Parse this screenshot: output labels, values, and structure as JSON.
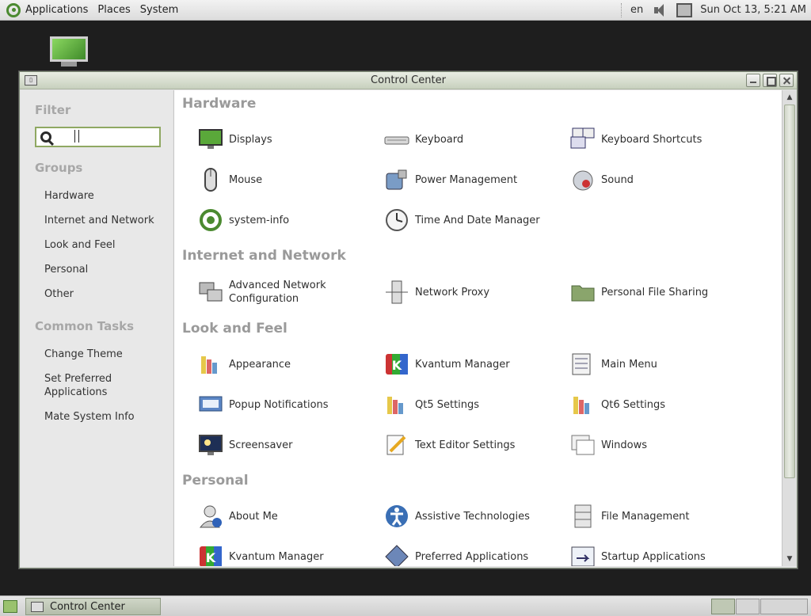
{
  "top_panel": {
    "menus": [
      "Applications",
      "Places",
      "System"
    ],
    "keyboard_layout": "en",
    "clock": "Sun Oct 13,  5:21 AM"
  },
  "window": {
    "title": "Control Center"
  },
  "sidebar": {
    "filter_heading": "Filter",
    "filter_value": "",
    "groups_heading": "Groups",
    "groups": [
      "Hardware",
      "Internet and Network",
      "Look and Feel",
      "Personal",
      "Other"
    ],
    "tasks_heading": "Common Tasks",
    "tasks": [
      "Change Theme",
      "Set Preferred Applications",
      "Mate System Info"
    ]
  },
  "content": {
    "categories": [
      {
        "name": "Hardware",
        "items": [
          {
            "label": "Displays",
            "icon": "display-icon"
          },
          {
            "label": "Keyboard",
            "icon": "keyboard-icon"
          },
          {
            "label": "Keyboard Shortcuts",
            "icon": "keyboard-shortcuts-icon"
          },
          {
            "label": "Mouse",
            "icon": "mouse-icon"
          },
          {
            "label": "Power Management",
            "icon": "power-management-icon"
          },
          {
            "label": "Sound",
            "icon": "sound-icon"
          },
          {
            "label": "system-info",
            "icon": "system-info-icon"
          },
          {
            "label": "Time And Date Manager",
            "icon": "clock-icon"
          }
        ]
      },
      {
        "name": "Internet and Network",
        "items": [
          {
            "label": "Advanced Network Configuration",
            "icon": "network-config-icon"
          },
          {
            "label": "Network Proxy",
            "icon": "network-proxy-icon"
          },
          {
            "label": "Personal File Sharing",
            "icon": "folder-share-icon"
          }
        ]
      },
      {
        "name": "Look and Feel",
        "items": [
          {
            "label": "Appearance",
            "icon": "appearance-icon"
          },
          {
            "label": "Kvantum Manager",
            "icon": "kvantum-icon"
          },
          {
            "label": "Main Menu",
            "icon": "main-menu-icon"
          },
          {
            "label": "Popup Notifications",
            "icon": "notification-icon"
          },
          {
            "label": "Qt5 Settings",
            "icon": "qt-settings-icon"
          },
          {
            "label": "Qt6 Settings",
            "icon": "qt-settings-icon"
          },
          {
            "label": "Screensaver",
            "icon": "screensaver-icon"
          },
          {
            "label": "Text Editor Settings",
            "icon": "text-editor-icon"
          },
          {
            "label": "Windows",
            "icon": "windows-icon"
          }
        ]
      },
      {
        "name": "Personal",
        "items": [
          {
            "label": "About Me",
            "icon": "user-icon"
          },
          {
            "label": "Assistive Technologies",
            "icon": "accessibility-icon"
          },
          {
            "label": "File Management",
            "icon": "file-cabinet-icon"
          },
          {
            "label": "Kvantum Manager",
            "icon": "kvantum-icon"
          },
          {
            "label": "Preferred Applications",
            "icon": "preferred-apps-icon"
          },
          {
            "label": "Startup Applications",
            "icon": "startup-apps-icon"
          }
        ]
      }
    ]
  },
  "taskbar": {
    "tasks": [
      "Control Center"
    ],
    "workspaces": 3,
    "active_workspace": 1
  },
  "colors": {
    "accent": "#8fa862",
    "title_gradient_top": "#e9ede4",
    "title_gradient_bottom": "#c7d0bd",
    "desktop": "#1e1e1e"
  }
}
